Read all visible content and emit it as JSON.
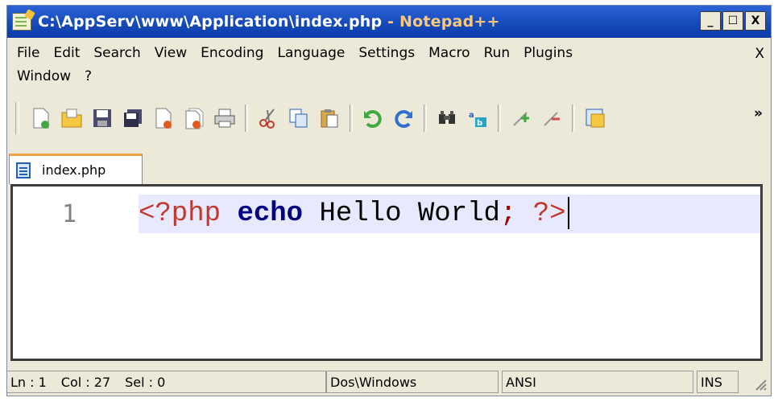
{
  "window": {
    "title_path": "C:\\AppServ\\www\\Application\\index.php",
    "title_suffix": " - Notepad++",
    "minimize": "_",
    "maximize": "☐",
    "close": "X"
  },
  "menu": {
    "row1": [
      "File",
      "Edit",
      "Search",
      "View",
      "Encoding",
      "Language",
      "Settings",
      "Macro",
      "Run",
      "Plugins"
    ],
    "row2": [
      "Window",
      "?"
    ],
    "close_doc": "X"
  },
  "toolbar": {
    "icons": [
      "new-file",
      "open-file",
      "save",
      "save-all",
      "close",
      "close-all",
      "print",
      "cut",
      "copy",
      "paste",
      "undo",
      "redo",
      "find",
      "replace",
      "zoom-in",
      "zoom-out",
      "sync-scroll"
    ],
    "overflow": "»"
  },
  "tab": {
    "label": "index.php"
  },
  "editor": {
    "line_number": "1",
    "tokens": {
      "open": "<?php",
      "keyword": "echo",
      "text": "Hello World",
      "semi": ";",
      "close": "?>"
    }
  },
  "status": {
    "ln": "Ln : 1",
    "col": "Col : 27",
    "sel": "Sel : 0",
    "eol": "Dos\\Windows",
    "encoding": "ANSI",
    "mode": "INS"
  },
  "colors": {
    "titlebar": "#1a4fbf",
    "tab_accent": "#f1a240",
    "php_tag": "#c0392b",
    "keyword": "#000080",
    "current_line": "#e8e8ff"
  }
}
